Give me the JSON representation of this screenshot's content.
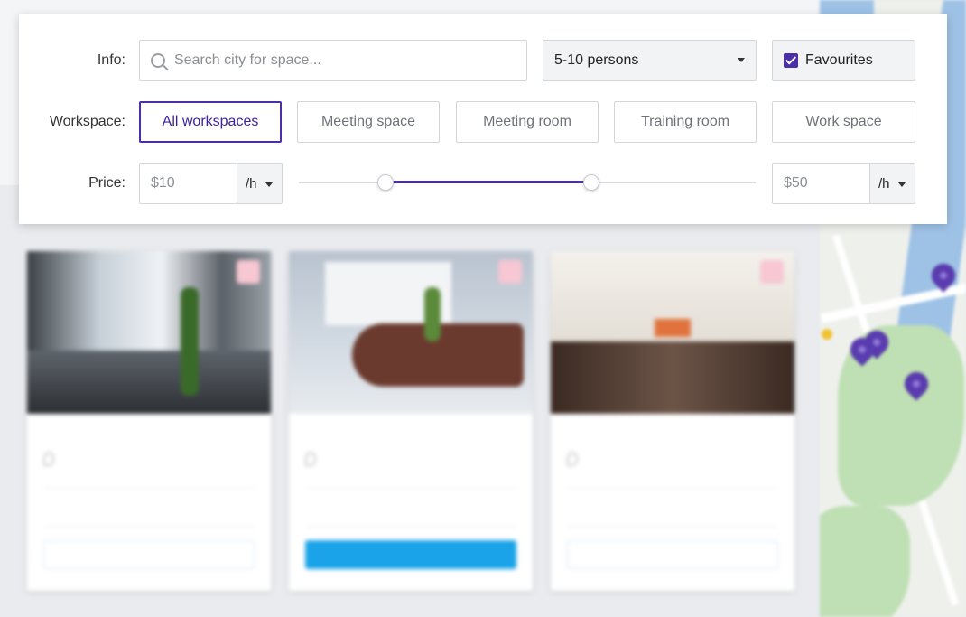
{
  "filters": {
    "info_label": "Info:",
    "search_placeholder": "Search city for space...",
    "persons_selected": "5-10 persons",
    "favourites_label": "Favourites",
    "favourites_checked": true,
    "workspace_label": "Workspace:",
    "workspace_options": [
      "All workspaces",
      "Meeting space",
      "Meeting room",
      "Training room",
      "Work space"
    ],
    "workspace_active": "All workspaces",
    "price_label": "Price:",
    "price_min": "$10",
    "price_min_unit": "/h",
    "price_max": "$50",
    "price_max_unit": "/h",
    "slider_low": 0.19,
    "slider_high": 0.64
  },
  "theme": {
    "accent": "#4b2fa8",
    "book_primary": "#1aa3e8"
  }
}
